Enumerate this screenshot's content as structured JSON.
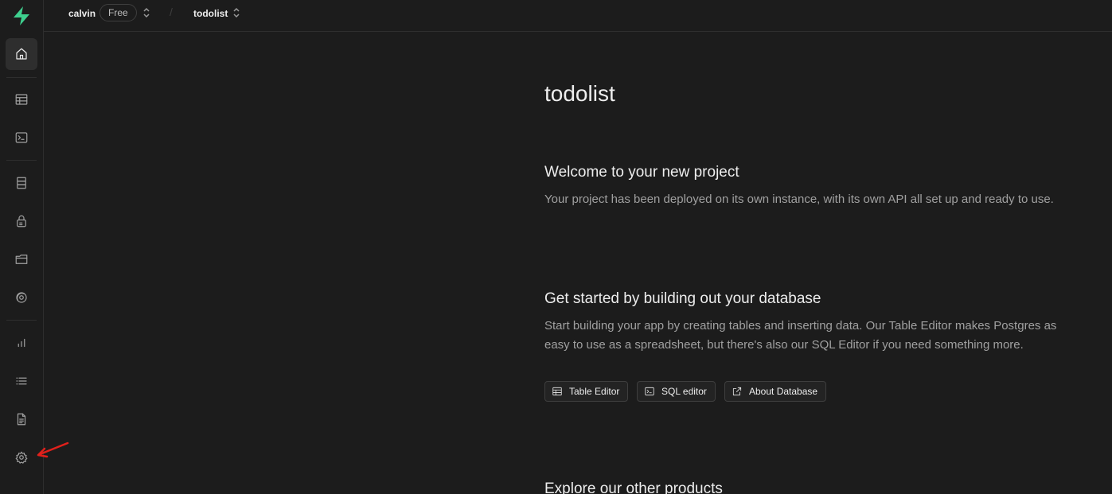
{
  "brand": {
    "accent": "#3ecf8e",
    "logo_icon": "supabase-logo-icon"
  },
  "topbar": {
    "org_name": "calvin",
    "plan_badge": "Free",
    "separator": "/",
    "project_name": "todolist"
  },
  "sidebar": {
    "items": [
      {
        "icon": "home-icon",
        "active": true
      },
      {
        "icon": "table-editor-icon"
      },
      {
        "icon": "sql-editor-icon"
      },
      {
        "icon": "database-icon"
      },
      {
        "icon": "auth-lock-icon"
      },
      {
        "icon": "storage-folder-icon"
      },
      {
        "icon": "realtime-icon"
      },
      {
        "icon": "reports-chart-icon"
      },
      {
        "icon": "logs-list-icon"
      },
      {
        "icon": "api-docs-icon"
      },
      {
        "icon": "settings-gear-icon"
      }
    ]
  },
  "main": {
    "title": "todolist",
    "welcome": {
      "heading": "Welcome to your new project",
      "text": "Your project has been deployed on its own instance, with its own API all set up and ready to use."
    },
    "database": {
      "heading": "Get started by building out your database",
      "text_line1": "Start building your app by creating tables and inserting data. Our Table Editor makes Postgres as",
      "text_line2": "easy to use as a spreadsheet, but there's also our SQL Editor if you need something more.",
      "buttons": [
        {
          "label": "Table Editor",
          "icon": "table-icon"
        },
        {
          "label": "SQL editor",
          "icon": "terminal-icon"
        },
        {
          "label": "About Database",
          "icon": "external-link-icon"
        }
      ]
    },
    "explore": {
      "heading": "Explore our other products"
    }
  },
  "annotation": {
    "arrow_color": "#e0201b"
  }
}
